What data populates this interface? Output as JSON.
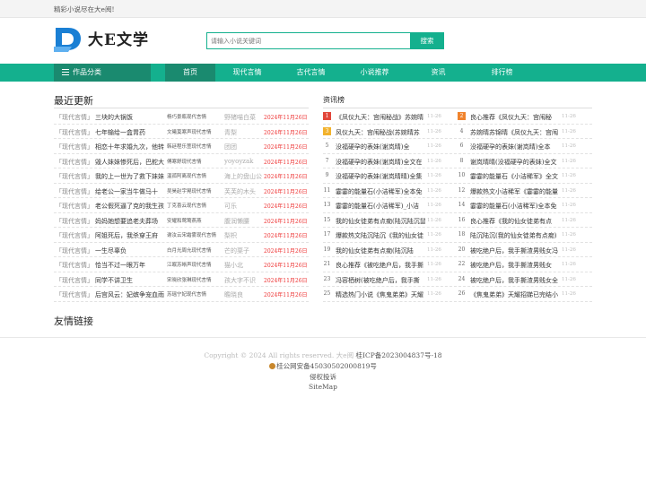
{
  "topbar": {
    "slogan": "精彩小说尽在大e阅!"
  },
  "header": {
    "logo_text": "大E文学"
  },
  "search": {
    "placeholder": "请输入小说关键词",
    "button_label": "搜索"
  },
  "colors": {
    "accent": "#14b08e",
    "accent_dark": "#1a8a6f",
    "date_red": "#e33333"
  },
  "nav": {
    "category_label": "作品分类",
    "items": [
      "首页",
      "现代言情",
      "古代言情",
      "小说推荐",
      "资讯",
      "排行榜"
    ],
    "active_index": 0
  },
  "latest": {
    "title": "最近更新",
    "rows": [
      {
        "cat": "「现代言情」",
        "title": "三块的大锅饭",
        "chapter": "杨巧景瓶现代言情",
        "author": "野猪喵白菜",
        "date": "2024年11月26日"
      },
      {
        "cat": "「现代言情」",
        "title": "七年输给一盒胃药",
        "chapter": "文曦莫寒声现代言情",
        "author": "青梨",
        "date": "2024年11月26日"
      },
      {
        "cat": "「现代言情」",
        "title": "相恋十年求婚九次，他转",
        "chapter": "韩廷程乐萱现代言情",
        "author": "团团",
        "date": "2024年11月26日"
      },
      {
        "cat": "「现代言情」",
        "title": "毁人妹妹惨死后，巴舵大",
        "chapter": "傅寒舒现代言情",
        "author": "yoyoyzak",
        "date": "2024年11月26日"
      },
      {
        "cat": "「现代言情」",
        "title": "我的上一世为了救下妹妹",
        "chapter": "温孤阿离现代言情",
        "author": "海上的盘山公",
        "date": "2024年11月26日"
      },
      {
        "cat": "「现代言情」",
        "title": "给老公一家当牛做马十",
        "chapter": "吴昊赵宇晃现代言情",
        "author": "芙芙的木头",
        "date": "2024年11月26日"
      },
      {
        "cat": "「现代言情」",
        "title": "老公假死逼了克的我生孩",
        "chapter": "丁克喜云现代言情",
        "author": "可乐",
        "date": "2024年11月26日"
      },
      {
        "cat": "「现代言情」",
        "title": "妈妈她想要追老夫葬场",
        "chapter": "安耀和莺莺燕燕",
        "author": "腹润懒腰",
        "date": "2024年11月26日"
      },
      {
        "cat": "「现代言情」",
        "title": "阿姐死后，我杀穿王府",
        "chapter": "谢汝云宋霜雾现代言情",
        "author": "梨枳",
        "date": "2024年11月26日"
      },
      {
        "cat": "「现代言情」",
        "title": "一生尽辜负",
        "chapter": "白月光周允现代言情",
        "author": "芒的栗子",
        "date": "2024年11月26日"
      },
      {
        "cat": "「现代言情」",
        "title": "恰当不过一眼万年",
        "chapter": "江眠苏晰声现代言情",
        "author": "猫小北",
        "date": "2024年11月26日"
      },
      {
        "cat": "「现代言情」",
        "title": "同学不讲卫生",
        "chapter": "宋晓欣张琳现代言情",
        "author": "孩大字不识",
        "date": "2024年11月26日"
      },
      {
        "cat": "「现代言情」",
        "title": "后宫风云：妃嫔争宠血雨",
        "chapter": "苏瑶宁妃现代言情",
        "author": "瞻晓良",
        "date": "2024年11月26日"
      }
    ]
  },
  "ranking": {
    "title": "资讯榜",
    "rows": [
      [
        {
          "num": "1",
          "name": "《凤仪九天：宫闱秘战》苏婉晴",
          "date": "11-26"
        },
        {
          "num": "2",
          "name": "良心推荐《凤仪九天：宫闱秘",
          "date": "11-26"
        }
      ],
      [
        {
          "num": "3",
          "name": "风仪九天：宫闱秘战(苏婉晴苏",
          "date": "11-26"
        },
        {
          "num": "4",
          "name": "苏婉晴苏锦晴《凤仪九天：宫闱",
          "date": "11-26"
        }
      ],
      [
        {
          "num": "5",
          "name": "没福硬孕的表妹(谢岚晴)全",
          "date": "11-26"
        },
        {
          "num": "6",
          "name": "没福硬孕的表妹(谢岚晴)全本",
          "date": "11-26"
        }
      ],
      [
        {
          "num": "7",
          "name": "没福硬孕的表妹(谢岚晴)全文在",
          "date": "11-26"
        },
        {
          "num": "8",
          "name": "谢岚晴晴(没福硬孕的表妹)全文",
          "date": "11-26"
        }
      ],
      [
        {
          "num": "9",
          "name": "没福硬孕的表妹(谢岚晴晴)全集",
          "date": "11-26"
        },
        {
          "num": "10",
          "name": "霎霎的能量石《小洁稀军》全文",
          "date": "11-26"
        }
      ],
      [
        {
          "num": "11",
          "name": "霎霎的能量石(小洁稀军)全本免",
          "date": "11-26"
        },
        {
          "num": "12",
          "name": "爆款热文小洁稀军《霎霎的能量",
          "date": "11-26"
        }
      ],
      [
        {
          "num": "13",
          "name": "霎霎的能量石(小洁稀军)_小洁",
          "date": "11-26"
        },
        {
          "num": "14",
          "name": "霎霎的能量石(小洁稀军)全本免",
          "date": "11-26"
        }
      ],
      [
        {
          "num": "15",
          "name": "我的仙女徒弟有点痴(陆沉陆沉鼠",
          "date": "11-26"
        },
        {
          "num": "16",
          "name": "良心推荐《我的仙女徒弟有点",
          "date": "11-26"
        }
      ],
      [
        {
          "num": "17",
          "name": "爆款热文陆沉陆沉《我的仙女徒",
          "date": "11-26"
        },
        {
          "num": "18",
          "name": "陆沉陆沉(我的仙女徒弟有点痴)",
          "date": "11-26"
        }
      ],
      [
        {
          "num": "19",
          "name": "我的仙女徒弟有点痴(陆沉陆",
          "date": "11-26"
        },
        {
          "num": "20",
          "name": "被吃绝户后，我手撕渣男贱女冯",
          "date": "11-26"
        }
      ],
      [
        {
          "num": "21",
          "name": "良心推荐《被吃绝户后，我手撕",
          "date": "11-26"
        },
        {
          "num": "22",
          "name": "被吃绝户后，我手撕渣男贱女",
          "date": "11-26"
        }
      ],
      [
        {
          "num": "23",
          "name": "冯容栖树(被吃绝户后，我手撕",
          "date": "11-26"
        },
        {
          "num": "24",
          "name": "被吃绝户后，我手撕渣男贱女全",
          "date": "11-26"
        }
      ],
      [
        {
          "num": "25",
          "name": "精选热门小说《焦鬼弟弟》天耀",
          "date": "11-26"
        },
        {
          "num": "26",
          "name": "《焦鬼弟弟》天耀招娣已完结小",
          "date": "11-26"
        }
      ]
    ]
  },
  "friends": {
    "title": "友情链接"
  },
  "footer": {
    "copyright": "Copyright © 2024 All rights reserved.  大e阅",
    "icp": "桂ICP备2023004837号-18",
    "police": "桂公网安备45030502000819号",
    "report": "侵权投诉",
    "sitemap": "SiteMap"
  }
}
